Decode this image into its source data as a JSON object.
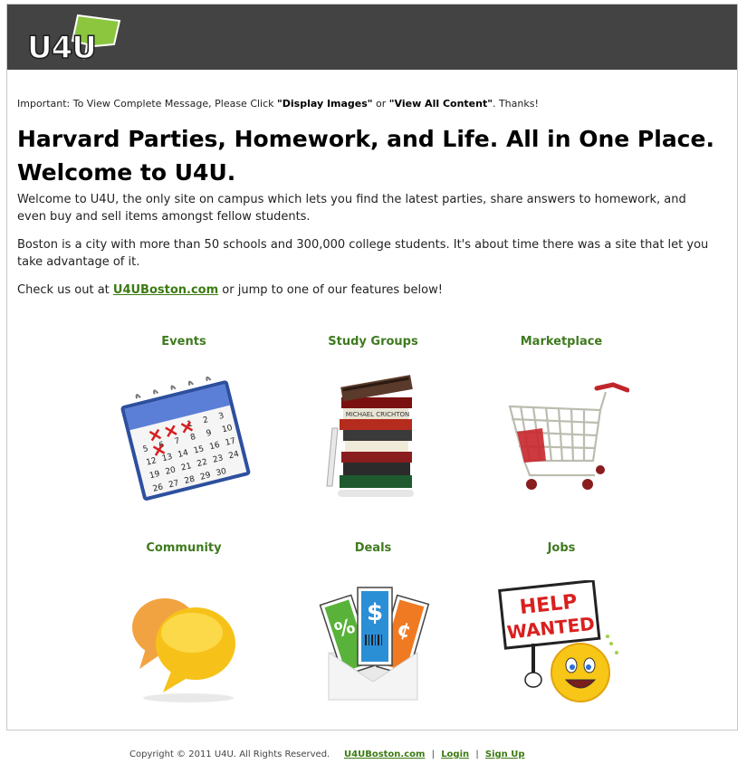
{
  "header": {
    "logo_text": "U4U"
  },
  "notice": {
    "prefix": "Important: To View Complete Message, Please Click ",
    "display_images": "\"Display Images\"",
    "or": " or ",
    "view_all": "\"View All Content\"",
    "suffix": ". Thanks!"
  },
  "headline": {
    "line1": "Harvard Parties, Homework, and Life. All in One Place.",
    "line2": "Welcome to U4U."
  },
  "paragraphs": {
    "intro": "Welcome to U4U, the only site on campus which lets you find the latest parties, share answers to homework, and even buy and sell items amongst fellow students.",
    "boston": "Boston is a city with more than 50 schools and 300,000 college students. It's about time there was a site that let you take advantage of it.",
    "check_prefix": "Check us out at ",
    "check_link": "U4UBoston.com",
    "check_suffix": " or jump to one of our features below!"
  },
  "features": [
    {
      "label": "Events",
      "icon": "calendar-icon"
    },
    {
      "label": "Study Groups",
      "icon": "books-icon"
    },
    {
      "label": "Marketplace",
      "icon": "shopping-cart-icon"
    },
    {
      "label": "Community",
      "icon": "speech-bubbles-icon"
    },
    {
      "label": "Deals",
      "icon": "coupons-icon"
    },
    {
      "label": "Jobs",
      "icon": "help-wanted-icon"
    }
  ],
  "book_spine_text": "MICHAEL CRICHTON",
  "calendar": {
    "rows": [
      [
        "",
        "",
        "",
        "1",
        "2",
        "3"
      ],
      [
        "5",
        "6",
        "7",
        "8",
        "9",
        "10"
      ],
      [
        "12",
        "13",
        "14",
        "15",
        "16",
        "17"
      ],
      [
        "19",
        "20",
        "21",
        "22",
        "23",
        "24"
      ],
      [
        "26",
        "27",
        "28",
        "29",
        "30",
        ""
      ]
    ]
  },
  "deals": {
    "percent": "%",
    "dollar": "$",
    "cent": "¢"
  },
  "jobs_sign": {
    "line1": "HELP",
    "line2": "WANTED"
  },
  "footer": {
    "copyright": "Copyright © 2011 U4U. All Rights Reserved.",
    "site_link": "U4UBoston.com",
    "login": "Login",
    "signup": "Sign Up",
    "separator": "|"
  },
  "colors": {
    "header_bg": "#434343",
    "accent_green": "#3c7a12",
    "logo_green": "#8cc63f"
  }
}
